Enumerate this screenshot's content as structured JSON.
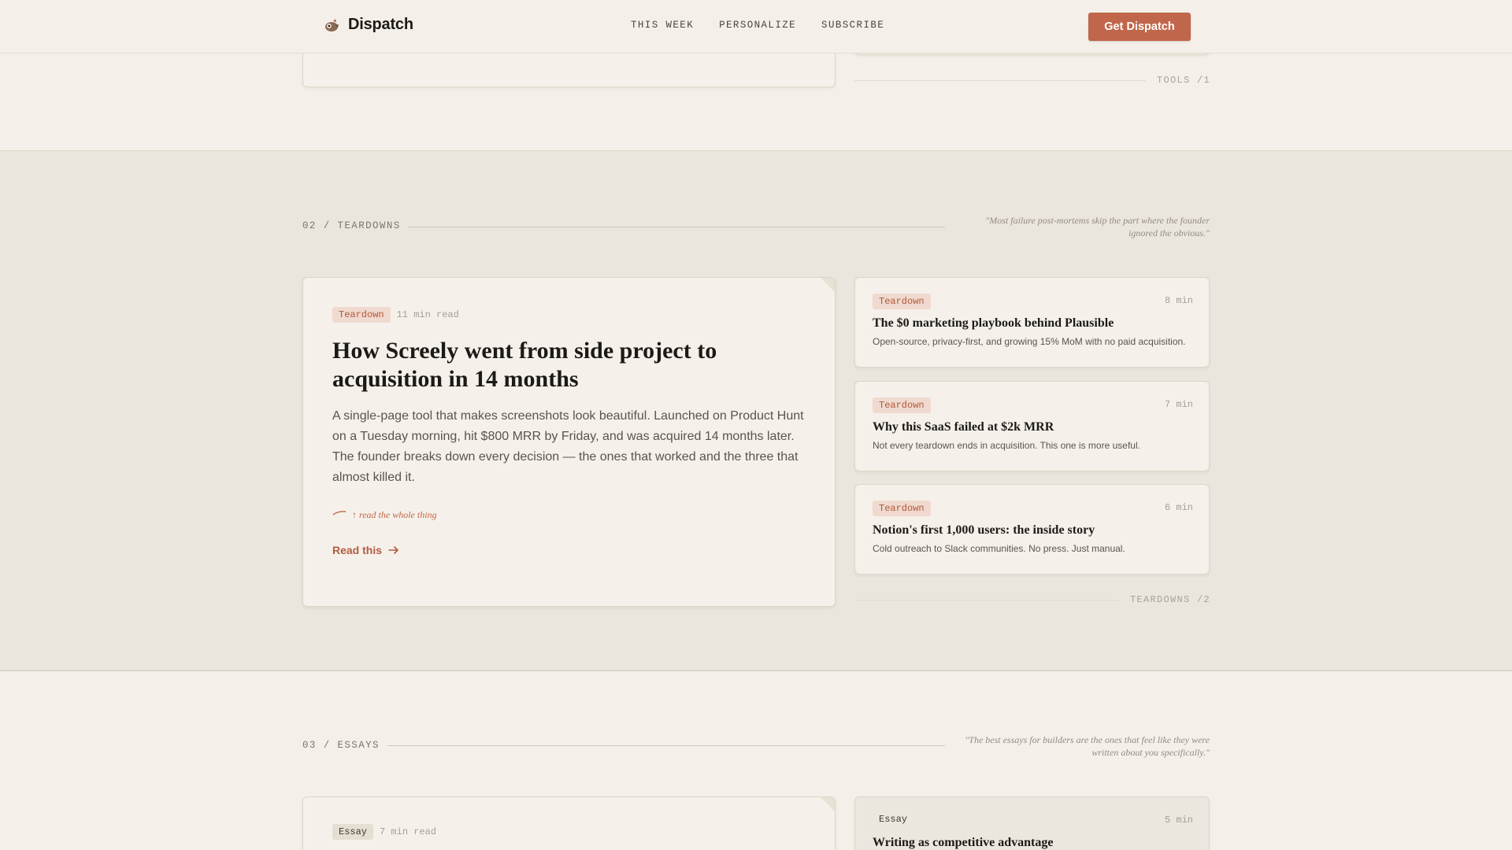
{
  "header": {
    "brand": "Dispatch",
    "nav": [
      "THIS WEEK",
      "PERSONALIZE",
      "SUBSCRIBE"
    ],
    "cta": "Get Dispatch"
  },
  "top_fragment": {
    "footer_label": "TOOLS /1"
  },
  "teardowns": {
    "label": "02 / TEARDOWNS",
    "quote": "\"Most failure post-mortems skip the part where the founder ignored the obvious.\"",
    "feature": {
      "tag": "Teardown",
      "read_time": "11 min read",
      "title": "How Screely went from side project to acquisition in 14 months",
      "description": "A single-page tool that makes screenshots look beautiful. Launched on Product Hunt on a Tuesday morning, hit $800 MRR by Friday, and was acquired 14 months later. The founder breaks down every decision — the ones that worked and the three that almost killed it.",
      "note": "↑ read the whole thing",
      "link": "Read this"
    },
    "items": [
      {
        "tag": "Teardown",
        "time": "8 min",
        "title": "The $0 marketing playbook behind Plausible",
        "description": "Open-source, privacy-first, and growing 15% MoM with no paid acquisition."
      },
      {
        "tag": "Teardown",
        "time": "7 min",
        "title": "Why this SaaS failed at $2k MRR",
        "description": "Not every teardown ends in acquisition. This one is more useful."
      },
      {
        "tag": "Teardown",
        "time": "6 min",
        "title": "Notion's first 1,000 users: the inside story",
        "description": "Cold outreach to Slack communities. No press. Just manual."
      }
    ],
    "footer_label": "TEARDOWNS /2"
  },
  "essays": {
    "label": "03 / ESSAYS",
    "quote": "\"The best essays for builders are the ones that feel like they were written about you specifically.\"",
    "feature": {
      "tag": "Essay",
      "read_time": "7 min read"
    },
    "items": [
      {
        "tag": "Essay",
        "time": "5 min",
        "title": "Writing as competitive advantage"
      }
    ]
  },
  "colors": {
    "accent": "#c0664a",
    "background": "#f4f0e9",
    "band": "#ebe6dd"
  }
}
